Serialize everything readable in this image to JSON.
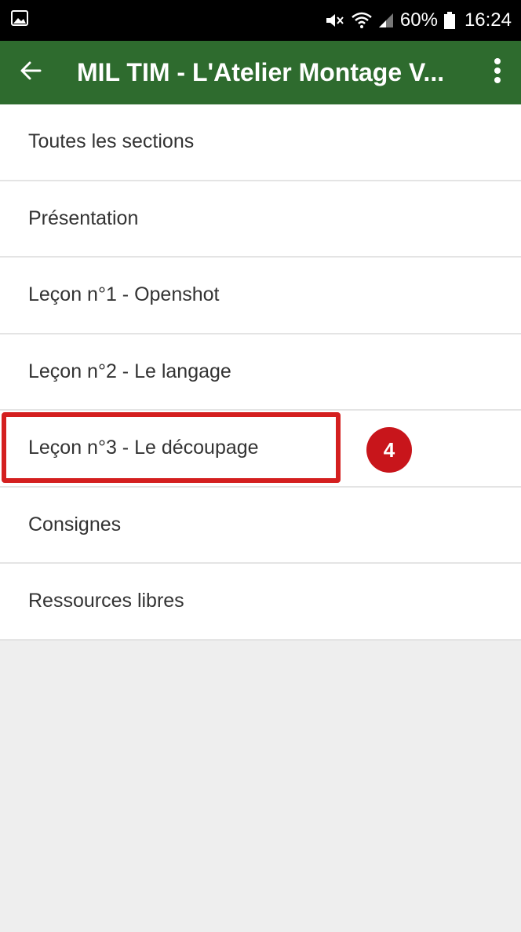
{
  "status_bar": {
    "battery": "60%",
    "time": "16:24"
  },
  "app_bar": {
    "title": "MIL TIM - L'Atelier Montage V..."
  },
  "sections": [
    {
      "label": "Toutes les sections"
    },
    {
      "label": "Présentation"
    },
    {
      "label": "Leçon n°1 - Openshot"
    },
    {
      "label": "Leçon n°2 - Le langage"
    },
    {
      "label": "Leçon n°3 - Le découpage"
    },
    {
      "label": "Consignes"
    },
    {
      "label": "Ressources libres"
    }
  ],
  "annotation": {
    "step": "4",
    "color": "#c8151b"
  },
  "colors": {
    "app_bar": "#2e6b2e",
    "status_bar": "#000000",
    "background": "#eeeeee"
  }
}
